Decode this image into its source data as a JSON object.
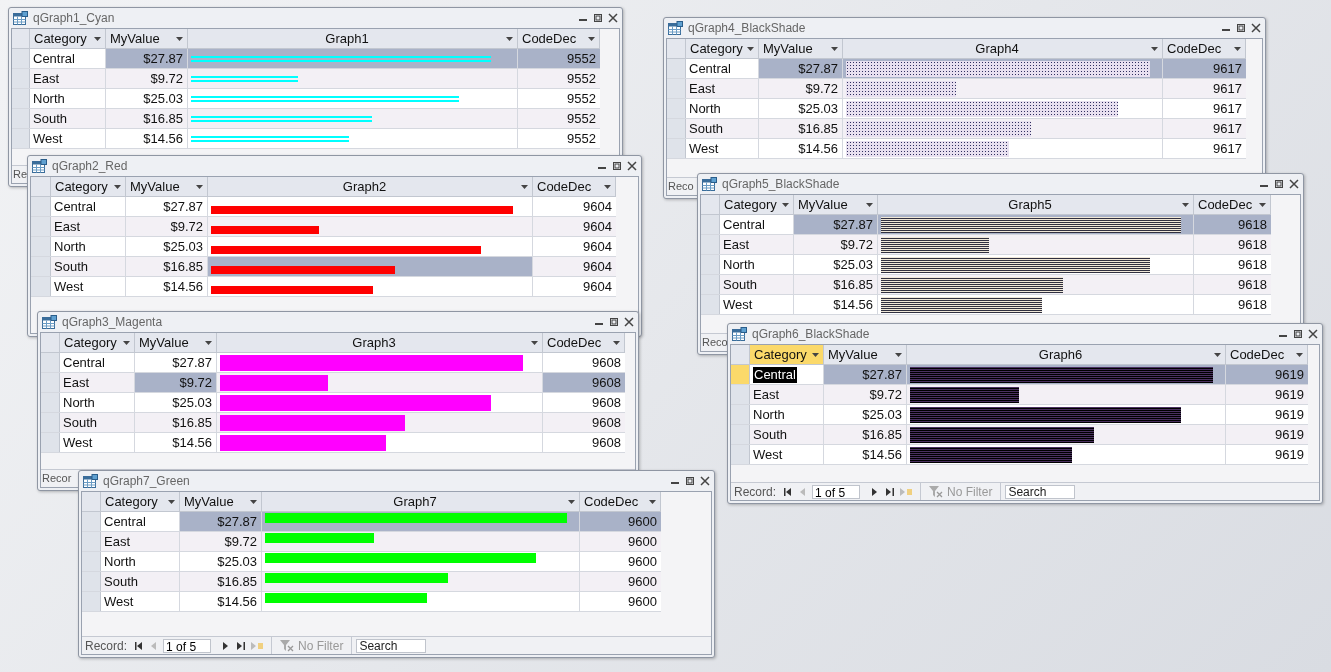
{
  "windows": [
    {
      "title": "qGraph1_Cyan",
      "columns": [
        "Category",
        "MyValue",
        "Graph1",
        "CodeDec"
      ],
      "kind": "lines",
      "color": "#00ffff",
      "focused": false,
      "highlight": {
        "value": true,
        "graph": true,
        "code": true
      },
      "rows": [
        {
          "category": "Central",
          "value": "$27.87",
          "level": 0.93,
          "code": "9552",
          "selected": true
        },
        {
          "category": "East",
          "value": "$9.72",
          "level": 0.33,
          "code": "9552",
          "selected": false
        },
        {
          "category": "North",
          "value": "$25.03",
          "level": 0.83,
          "code": "9552",
          "selected": false
        },
        {
          "category": "South",
          "value": "$16.85",
          "level": 0.56,
          "code": "9552",
          "selected": false
        },
        {
          "category": "West",
          "value": "$14.56",
          "level": 0.49,
          "code": "9552",
          "selected": false
        }
      ],
      "nav": {
        "label": "Re"
      }
    },
    {
      "title": "qGraph4_BlackShade",
      "columns": [
        "Category",
        "MyValue",
        "Graph4",
        "CodeDec"
      ],
      "kind": "dots",
      "focused": false,
      "highlight": {
        "value": true,
        "graph": true,
        "code": true
      },
      "rows": [
        {
          "category": "Central",
          "value": "$27.87",
          "level": 0.97,
          "code": "9617",
          "selected": true
        },
        {
          "category": "East",
          "value": "$9.72",
          "level": 0.35,
          "code": "9617",
          "selected": false
        },
        {
          "category": "North",
          "value": "$25.03",
          "level": 0.87,
          "code": "9617",
          "selected": false
        },
        {
          "category": "South",
          "value": "$16.85",
          "level": 0.59,
          "code": "9617",
          "selected": false
        },
        {
          "category": "West",
          "value": "$14.56",
          "level": 0.52,
          "code": "9617",
          "selected": false
        }
      ],
      "nav": {
        "label": "Reco"
      }
    },
    {
      "title": "qGraph2_Red",
      "columns": [
        "Category",
        "MyValue",
        "Graph2",
        "CodeDec"
      ],
      "kind": "low",
      "color": "#ff0000",
      "focused": false,
      "highlight": {
        "value": false,
        "graph": true,
        "code": false
      },
      "rows": [
        {
          "category": "Central",
          "value": "$27.87",
          "level": 0.95,
          "code": "9604",
          "selected": false
        },
        {
          "category": "East",
          "value": "$9.72",
          "level": 0.34,
          "code": "9604",
          "selected": false
        },
        {
          "category": "North",
          "value": "$25.03",
          "level": 0.85,
          "code": "9604",
          "selected": false
        },
        {
          "category": "South",
          "value": "$16.85",
          "level": 0.58,
          "code": "9604",
          "selected": true
        },
        {
          "category": "West",
          "value": "$14.56",
          "level": 0.51,
          "code": "9604",
          "selected": false
        }
      ]
    },
    {
      "title": "qGraph5_BlackShade",
      "columns": [
        "Category",
        "MyValue",
        "Graph5",
        "CodeDec"
      ],
      "kind": "stripes",
      "focused": false,
      "highlight": {
        "value": true,
        "graph": true,
        "code": true
      },
      "rows": [
        {
          "category": "Central",
          "value": "$27.87",
          "level": 0.97,
          "code": "9618",
          "selected": true
        },
        {
          "category": "East",
          "value": "$9.72",
          "level": 0.35,
          "code": "9618",
          "selected": false
        },
        {
          "category": "North",
          "value": "$25.03",
          "level": 0.87,
          "code": "9618",
          "selected": false
        },
        {
          "category": "South",
          "value": "$16.85",
          "level": 0.59,
          "code": "9618",
          "selected": false
        },
        {
          "category": "West",
          "value": "$14.56",
          "level": 0.52,
          "code": "9618",
          "selected": false
        }
      ],
      "nav": {
        "label": "Reco"
      }
    },
    {
      "title": "qGraph3_Magenta",
      "columns": [
        "Category",
        "MyValue",
        "Graph3",
        "CodeDec"
      ],
      "kind": "full",
      "color": "#ff00ff",
      "focused": false,
      "highlight": {
        "value": true,
        "graph": false,
        "code": true
      },
      "rows": [
        {
          "category": "Central",
          "value": "$27.87",
          "level": 0.95,
          "code": "9608",
          "selected": false
        },
        {
          "category": "East",
          "value": "$9.72",
          "level": 0.34,
          "code": "9608",
          "selected": true
        },
        {
          "category": "North",
          "value": "$25.03",
          "level": 0.85,
          "code": "9608",
          "selected": false
        },
        {
          "category": "South",
          "value": "$16.85",
          "level": 0.58,
          "code": "9608",
          "selected": false
        },
        {
          "category": "West",
          "value": "$14.56",
          "level": 0.52,
          "code": "9608",
          "selected": false
        }
      ],
      "nav": {
        "label": "Recor"
      }
    },
    {
      "title": "qGraph6_BlackShade",
      "columns": [
        "Category",
        "MyValue",
        "Graph6",
        "CodeDec"
      ],
      "kind": "dense",
      "focused": true,
      "highlight": {
        "value": true,
        "graph": true,
        "code": true
      },
      "rows": [
        {
          "category": "Central",
          "value": "$27.87",
          "level": 0.97,
          "code": "9619",
          "selected": true
        },
        {
          "category": "East",
          "value": "$9.72",
          "level": 0.35,
          "code": "9619",
          "selected": false
        },
        {
          "category": "North",
          "value": "$25.03",
          "level": 0.87,
          "code": "9619",
          "selected": false
        },
        {
          "category": "South",
          "value": "$16.85",
          "level": 0.59,
          "code": "9619",
          "selected": false
        },
        {
          "category": "West",
          "value": "$14.56",
          "level": 0.52,
          "code": "9619",
          "selected": false
        }
      ],
      "nav": {
        "label": "Record:",
        "position": "1 of 5",
        "filter": "No Filter",
        "search": {
          "placeholder": "Search"
        }
      }
    },
    {
      "title": "qGraph7_Green",
      "columns": [
        "Category",
        "MyValue",
        "Graph7",
        "CodeDec"
      ],
      "kind": "high",
      "color": "#00ff00",
      "focused": false,
      "highlight": {
        "value": true,
        "graph": true,
        "code": true
      },
      "rows": [
        {
          "category": "Central",
          "value": "$27.87",
          "level": 0.97,
          "code": "9600",
          "selected": true
        },
        {
          "category": "East",
          "value": "$9.72",
          "level": 0.35,
          "code": "9600",
          "selected": false
        },
        {
          "category": "North",
          "value": "$25.03",
          "level": 0.87,
          "code": "9600",
          "selected": false
        },
        {
          "category": "South",
          "value": "$16.85",
          "level": 0.59,
          "code": "9600",
          "selected": false
        },
        {
          "category": "West",
          "value": "$14.56",
          "level": 0.52,
          "code": "9600",
          "selected": false
        }
      ],
      "nav": {
        "label": "Record:",
        "position": "1 of 5",
        "filter": "No Filter",
        "search": {
          "placeholder": "Search"
        }
      }
    }
  ]
}
